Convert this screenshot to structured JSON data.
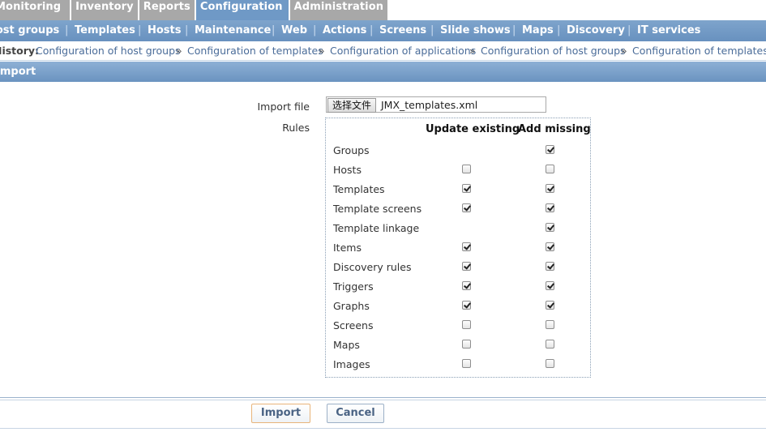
{
  "top_tabs": [
    {
      "label": "Monitoring"
    },
    {
      "label": "Inventory"
    },
    {
      "label": "Reports"
    },
    {
      "label": "Configuration",
      "active": true
    },
    {
      "label": "Administration"
    }
  ],
  "sub_nav": [
    {
      "label": "Host groups"
    },
    {
      "label": "Templates"
    },
    {
      "label": "Hosts"
    },
    {
      "label": "Maintenance"
    },
    {
      "label": "Web"
    },
    {
      "label": "Actions"
    },
    {
      "label": "Screens"
    },
    {
      "label": "Slide shows"
    },
    {
      "label": "Maps"
    },
    {
      "label": "Discovery"
    },
    {
      "label": "IT services"
    }
  ],
  "sub_nav_separator": "|",
  "history": {
    "label": "History:",
    "separator": "»",
    "items": [
      "Configuration of host groups",
      "Configuration of templates",
      "Configuration of applications",
      "Configuration of host groups",
      "Configuration of templates"
    ]
  },
  "header": {
    "title": "Import"
  },
  "form": {
    "import_file_label": "Import file",
    "file_button_label": "选择文件",
    "file_name": "JMX_templates.xml",
    "rules_label": "Rules",
    "col_update": "Update existing",
    "col_add": "Add missing",
    "rules": [
      {
        "name": "Groups",
        "update": null,
        "add": true
      },
      {
        "name": "Hosts",
        "update": false,
        "add": false
      },
      {
        "name": "Templates",
        "update": true,
        "add": true
      },
      {
        "name": "Template screens",
        "update": true,
        "add": true
      },
      {
        "name": "Template linkage",
        "update": null,
        "add": true
      },
      {
        "name": "Items",
        "update": true,
        "add": true
      },
      {
        "name": "Discovery rules",
        "update": true,
        "add": true
      },
      {
        "name": "Triggers",
        "update": true,
        "add": true
      },
      {
        "name": "Graphs",
        "update": true,
        "add": true
      },
      {
        "name": "Screens",
        "update": false,
        "add": false
      },
      {
        "name": "Maps",
        "update": false,
        "add": false
      },
      {
        "name": "Images",
        "update": false,
        "add": false
      }
    ]
  },
  "buttons": {
    "import": "Import",
    "cancel": "Cancel"
  },
  "colors": {
    "active_tab": "#6f99c6",
    "tab": "#a8a8a8",
    "subnav": "#7ea4cc",
    "link": "#4a6c99"
  }
}
